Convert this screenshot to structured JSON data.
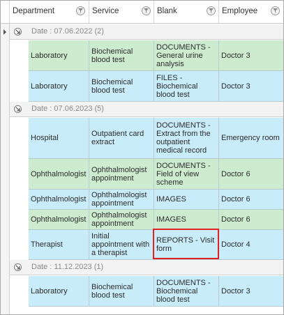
{
  "columns": [
    {
      "key": "department",
      "label": "Department"
    },
    {
      "key": "service",
      "label": "Service"
    },
    {
      "key": "blank",
      "label": "Blank"
    },
    {
      "key": "employee",
      "label": "Employee"
    }
  ],
  "groups": [
    {
      "label": "Date : 07.06.2022 (2)",
      "rows": [
        {
          "color": "green",
          "department": "Laboratory",
          "service": "Biochemical blood test",
          "blank": "DOCUMENTS - General urine analysis",
          "employee": "Doctor 3"
        },
        {
          "color": "blue",
          "department": "Laboratory",
          "service": "Biochemical blood test",
          "blank": "FILES - Biochemical blood test",
          "employee": "Doctor 3"
        }
      ]
    },
    {
      "label": "Date : 07.06.2023 (5)",
      "rows": [
        {
          "color": "blue",
          "department": "Hospital",
          "service": "Outpatient card extract",
          "blank": "DOCUMENTS - Extract from the outpatient medical record",
          "employee": "Emergency room"
        },
        {
          "color": "green",
          "department": "Ophthalmologist",
          "service": "Ophthalmologist appointment",
          "blank": "DOCUMENTS - Field of view scheme",
          "employee": "Doctor 6"
        },
        {
          "color": "blue",
          "department": "Ophthalmologist",
          "service": "Ophthalmologist appointment",
          "blank": "IMAGES",
          "employee": "Doctor 6"
        },
        {
          "color": "green",
          "department": "Ophthalmologist",
          "service": "Ophthalmologist appointment",
          "blank": "IMAGES",
          "employee": "Doctor 6"
        },
        {
          "color": "blue",
          "department": "Therapist",
          "service": "Initial appointment with a therapist",
          "blank": "REPORTS - Visit form",
          "employee": "Doctor 4",
          "highlight_blank": true
        }
      ]
    },
    {
      "label": "Date : 11.12.2023 (1)",
      "rows": [
        {
          "color": "blue",
          "department": "Laboratory",
          "service": "Biochemical blood test",
          "blank": "DOCUMENTS - Biochemical blood test",
          "employee": "Doctor 3"
        }
      ]
    }
  ],
  "colors": {
    "row_green": "#cdeccf",
    "row_blue": "#c9ecfa",
    "group_bg": "#f3f3f3",
    "highlight": "#e02020"
  }
}
